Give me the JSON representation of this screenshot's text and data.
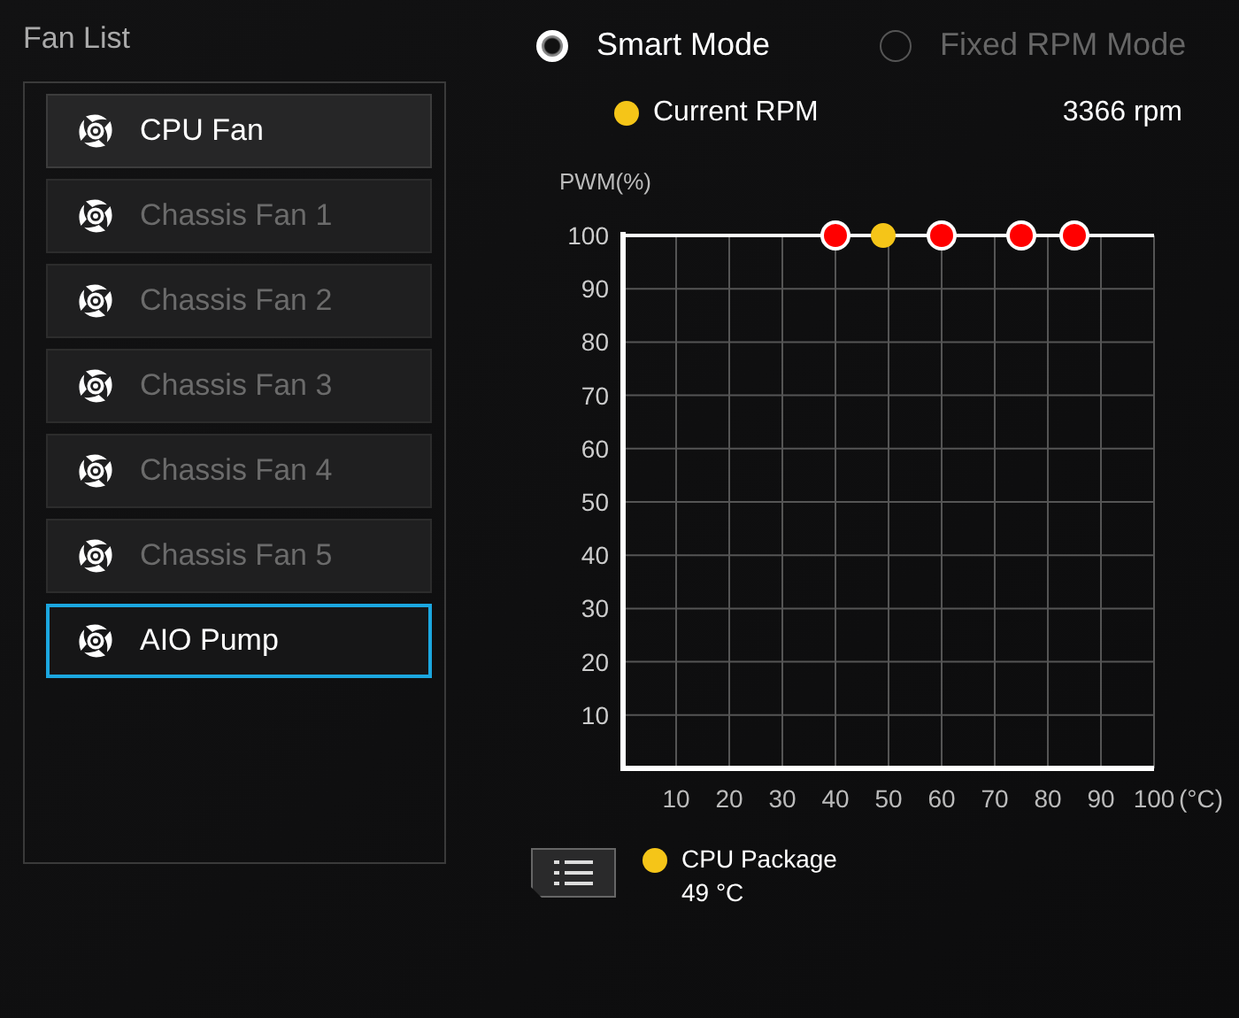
{
  "fan_list": {
    "title": "Fan List",
    "items": [
      {
        "label": "CPU Fan",
        "selected": false,
        "disabled": false
      },
      {
        "label": "Chassis Fan 1",
        "selected": false,
        "disabled": true
      },
      {
        "label": "Chassis Fan 2",
        "selected": false,
        "disabled": true
      },
      {
        "label": "Chassis Fan 3",
        "selected": false,
        "disabled": true
      },
      {
        "label": "Chassis Fan 4",
        "selected": false,
        "disabled": true
      },
      {
        "label": "Chassis Fan 5",
        "selected": false,
        "disabled": true
      },
      {
        "label": "AIO Pump",
        "selected": true,
        "disabled": false
      }
    ]
  },
  "modes": [
    {
      "label": "Smart Mode",
      "selected": true
    },
    {
      "label": "Fixed RPM Mode",
      "selected": false
    }
  ],
  "current_rpm": {
    "label": "Current RPM",
    "color": "#f5c518",
    "value": "3366 rpm"
  },
  "chart": {
    "chart_data": {
      "type": "line",
      "ylabel": "PWM(%)",
      "xlabel": "(°C)",
      "x": [
        0,
        40,
        60,
        75,
        85,
        100
      ],
      "series": [
        {
          "color": "#ffffff",
          "values": [
            100,
            100,
            100,
            100,
            100,
            100
          ]
        }
      ],
      "grid": true,
      "xlim": [
        0,
        100
      ],
      "ylim": [
        0,
        100
      ],
      "xticks": [
        10,
        20,
        30,
        40,
        50,
        60,
        70,
        80,
        90,
        100
      ],
      "yticks": [
        10,
        20,
        30,
        40,
        50,
        60,
        70,
        80,
        90,
        100
      ]
    }
  },
  "sensor": {
    "label": "CPU Package",
    "value": "49 °C",
    "color": "#f5c518"
  }
}
